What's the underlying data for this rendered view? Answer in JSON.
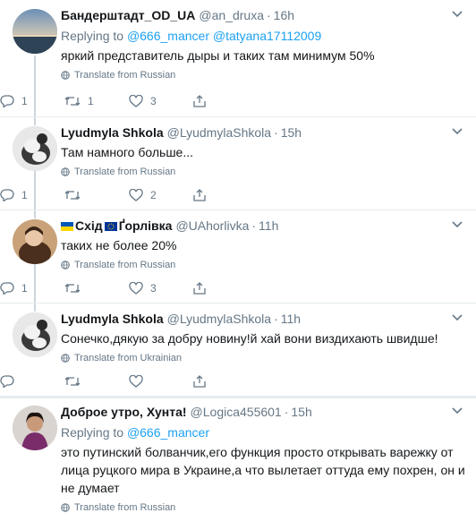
{
  "tweets": [
    {
      "name": "Бандерштадт_OD_UA",
      "handle": "@an_druxa",
      "time": "16h",
      "replying_prefix": "Replying to",
      "mentions": "@666_mancer @tatyana17112009",
      "text": "яркий представитель дыры и таких там минимум 50%",
      "translate": "Translate from Russian",
      "replies": "1",
      "retweets": "1",
      "likes": "3"
    },
    {
      "name": "Lyudmyla Shkola",
      "handle": "@LyudmylaShkola",
      "time": "15h",
      "text": "Там намного больше...",
      "translate": "Translate from Russian",
      "replies": "1",
      "retweets": "",
      "likes": "2"
    },
    {
      "name_part1": "Схід",
      "name_part2": "Ґорлівка",
      "handle": "@UAhorlivka",
      "time": "11h",
      "text": "таких не более 20%",
      "translate": "Translate from Russian",
      "replies": "1",
      "retweets": "",
      "likes": "3"
    },
    {
      "name": "Lyudmyla Shkola",
      "handle": "@LyudmylaShkola",
      "time": "11h",
      "text": "Сонечко,дякую за добру новину!й хай вони виздихають швидше!",
      "translate": "Translate from Ukrainian",
      "replies": "",
      "retweets": "",
      "likes": ""
    },
    {
      "name": "Доброе утро, Хунта!",
      "handle": "@Logica455601",
      "time": "15h",
      "replying_prefix": "Replying to",
      "mentions": "@666_mancer",
      "text": "это путинский болванчик,его функция просто открывать варежку от лица руцкого мира в Украине,а что вылетает оттуда ему похрен, он и не думает",
      "translate": "Translate from Russian"
    }
  ],
  "colors": {
    "accent": "#1da1f2",
    "secondary_text": "#657786",
    "divider": "#e6ecf0",
    "thread_line": "#ccd6dd"
  },
  "icons": [
    "reply-icon",
    "retweet-icon",
    "like-icon",
    "share-icon",
    "globe-icon",
    "chevron-down-icon"
  ]
}
